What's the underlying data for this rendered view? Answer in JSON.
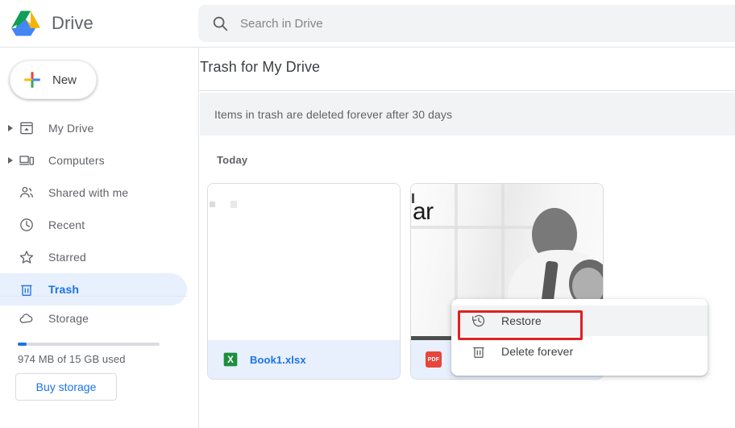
{
  "app": {
    "brand_title": "Drive",
    "logo_icon": "google-drive-logo"
  },
  "search": {
    "placeholder": "Search in Drive",
    "value": "",
    "icon": "search-icon"
  },
  "sidebar": {
    "new_button": {
      "label": "New",
      "icon": "google-plus-icon"
    },
    "items": [
      {
        "label": "My Drive",
        "icon": "my-drive-icon",
        "expandable": true,
        "active": false
      },
      {
        "label": "Computers",
        "icon": "computers-icon",
        "expandable": true,
        "active": false
      },
      {
        "label": "Shared with me",
        "icon": "shared-with-me-icon",
        "expandable": false,
        "active": false
      },
      {
        "label": "Recent",
        "icon": "clock-icon",
        "expandable": false,
        "active": false
      },
      {
        "label": "Starred",
        "icon": "star-icon",
        "expandable": false,
        "active": false
      },
      {
        "label": "Trash",
        "icon": "trash-icon",
        "expandable": false,
        "active": true
      }
    ],
    "storage": {
      "label": "Storage",
      "icon": "cloud-icon",
      "used_text": "974 MB of 15 GB used",
      "percent_used": 6.5,
      "buy_button_label": "Buy storage"
    }
  },
  "main": {
    "page_title": "Trash for My Drive",
    "notice": "Items in trash are deleted forever after 30 days",
    "section_label": "Today",
    "files": [
      {
        "name": "Book1.xlsx",
        "type": "xlsx",
        "type_icon": "excel-icon",
        "selected": true,
        "thumbnail": "blank-spreadsheet"
      },
      {
        "name": "",
        "type": "pdf",
        "type_icon": "pdf-icon",
        "type_badge_label": "PDF",
        "selected": true,
        "thumbnail": "business-people-photo",
        "thumbnail_text": "ar"
      }
    ]
  },
  "context_menu": {
    "items": [
      {
        "label": "Restore",
        "icon": "restore-icon",
        "highlighted": true
      },
      {
        "label": "Delete forever",
        "icon": "delete-trash-icon",
        "highlighted": false
      }
    ],
    "annotation_color": "#e02020"
  },
  "colors": {
    "accent_blue": "#1a73e8",
    "selected_bg": "#e8f0fe",
    "banner_bg": "#f1f3f4",
    "text_secondary": "#5f6368",
    "annotation_red": "#e02020"
  }
}
